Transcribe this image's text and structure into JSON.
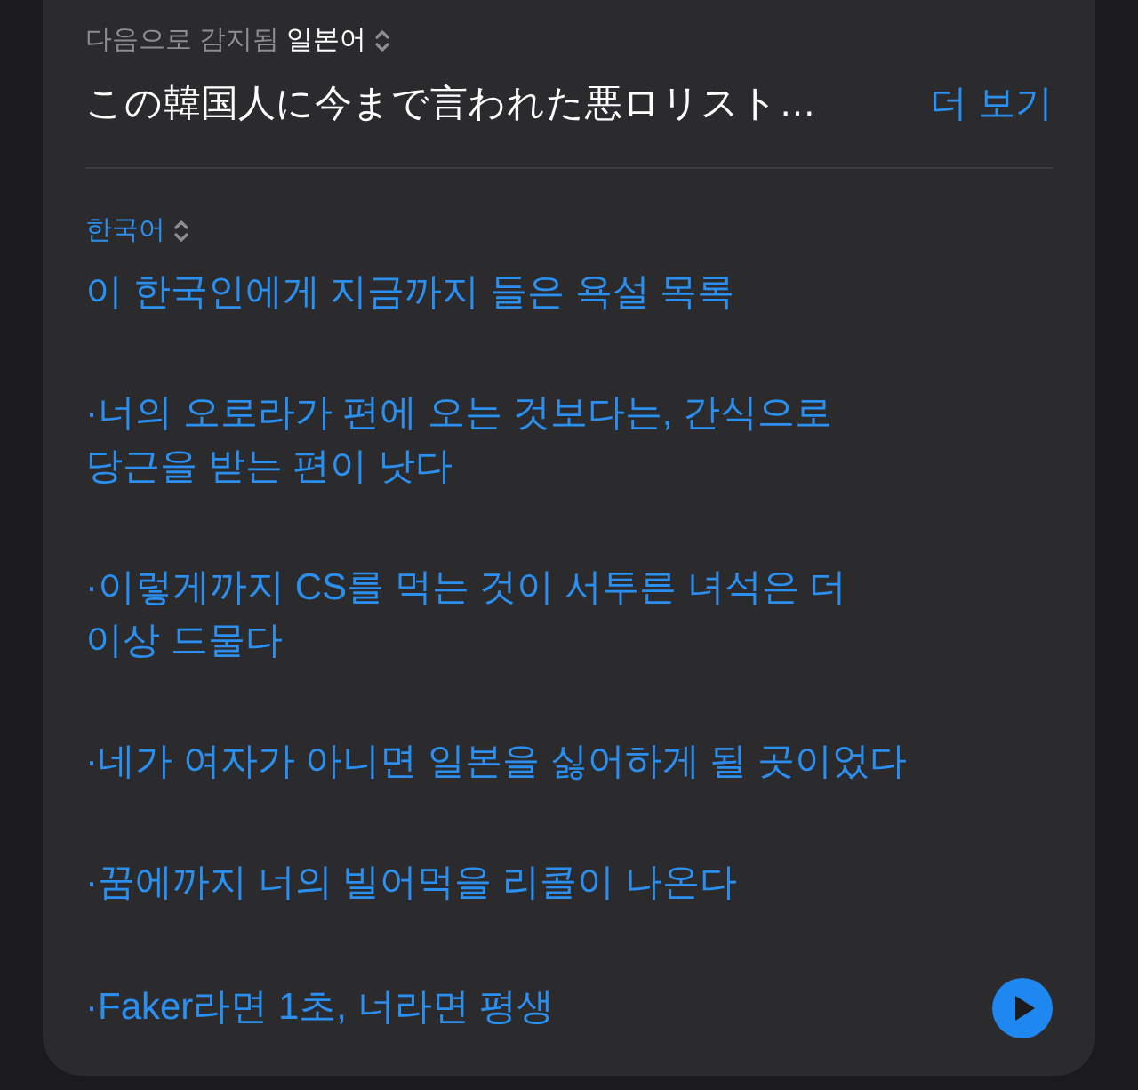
{
  "source": {
    "detected_label": "다음으로 감지됨",
    "language": "일본어",
    "text": "この韓国人に今まで言われた悪ロリスト…",
    "more_link": "더 보기"
  },
  "translation": {
    "language": "한국어",
    "paragraphs": [
      {
        "lines": [
          "이 한국인에게 지금까지 들은 욕설 목록"
        ]
      },
      {
        "lines": [
          "·너의 오로라가 편에 오는 것보다는, 간식으로",
          "당근을 받는 편이 낫다"
        ]
      },
      {
        "lines": [
          "·이렇게까지 CS를 먹는 것이 서투른 녀석은 더",
          "이상 드물다"
        ]
      },
      {
        "lines": [
          "·네가 여자가 아니면 일본을 싫어하게 될 곳이었다"
        ]
      },
      {
        "lines": [
          "·꿈에까지 너의 빌어먹을 리콜이 나온다"
        ]
      },
      {
        "lines": [
          "·Faker라면 1초, 너라면 평생"
        ]
      }
    ]
  }
}
